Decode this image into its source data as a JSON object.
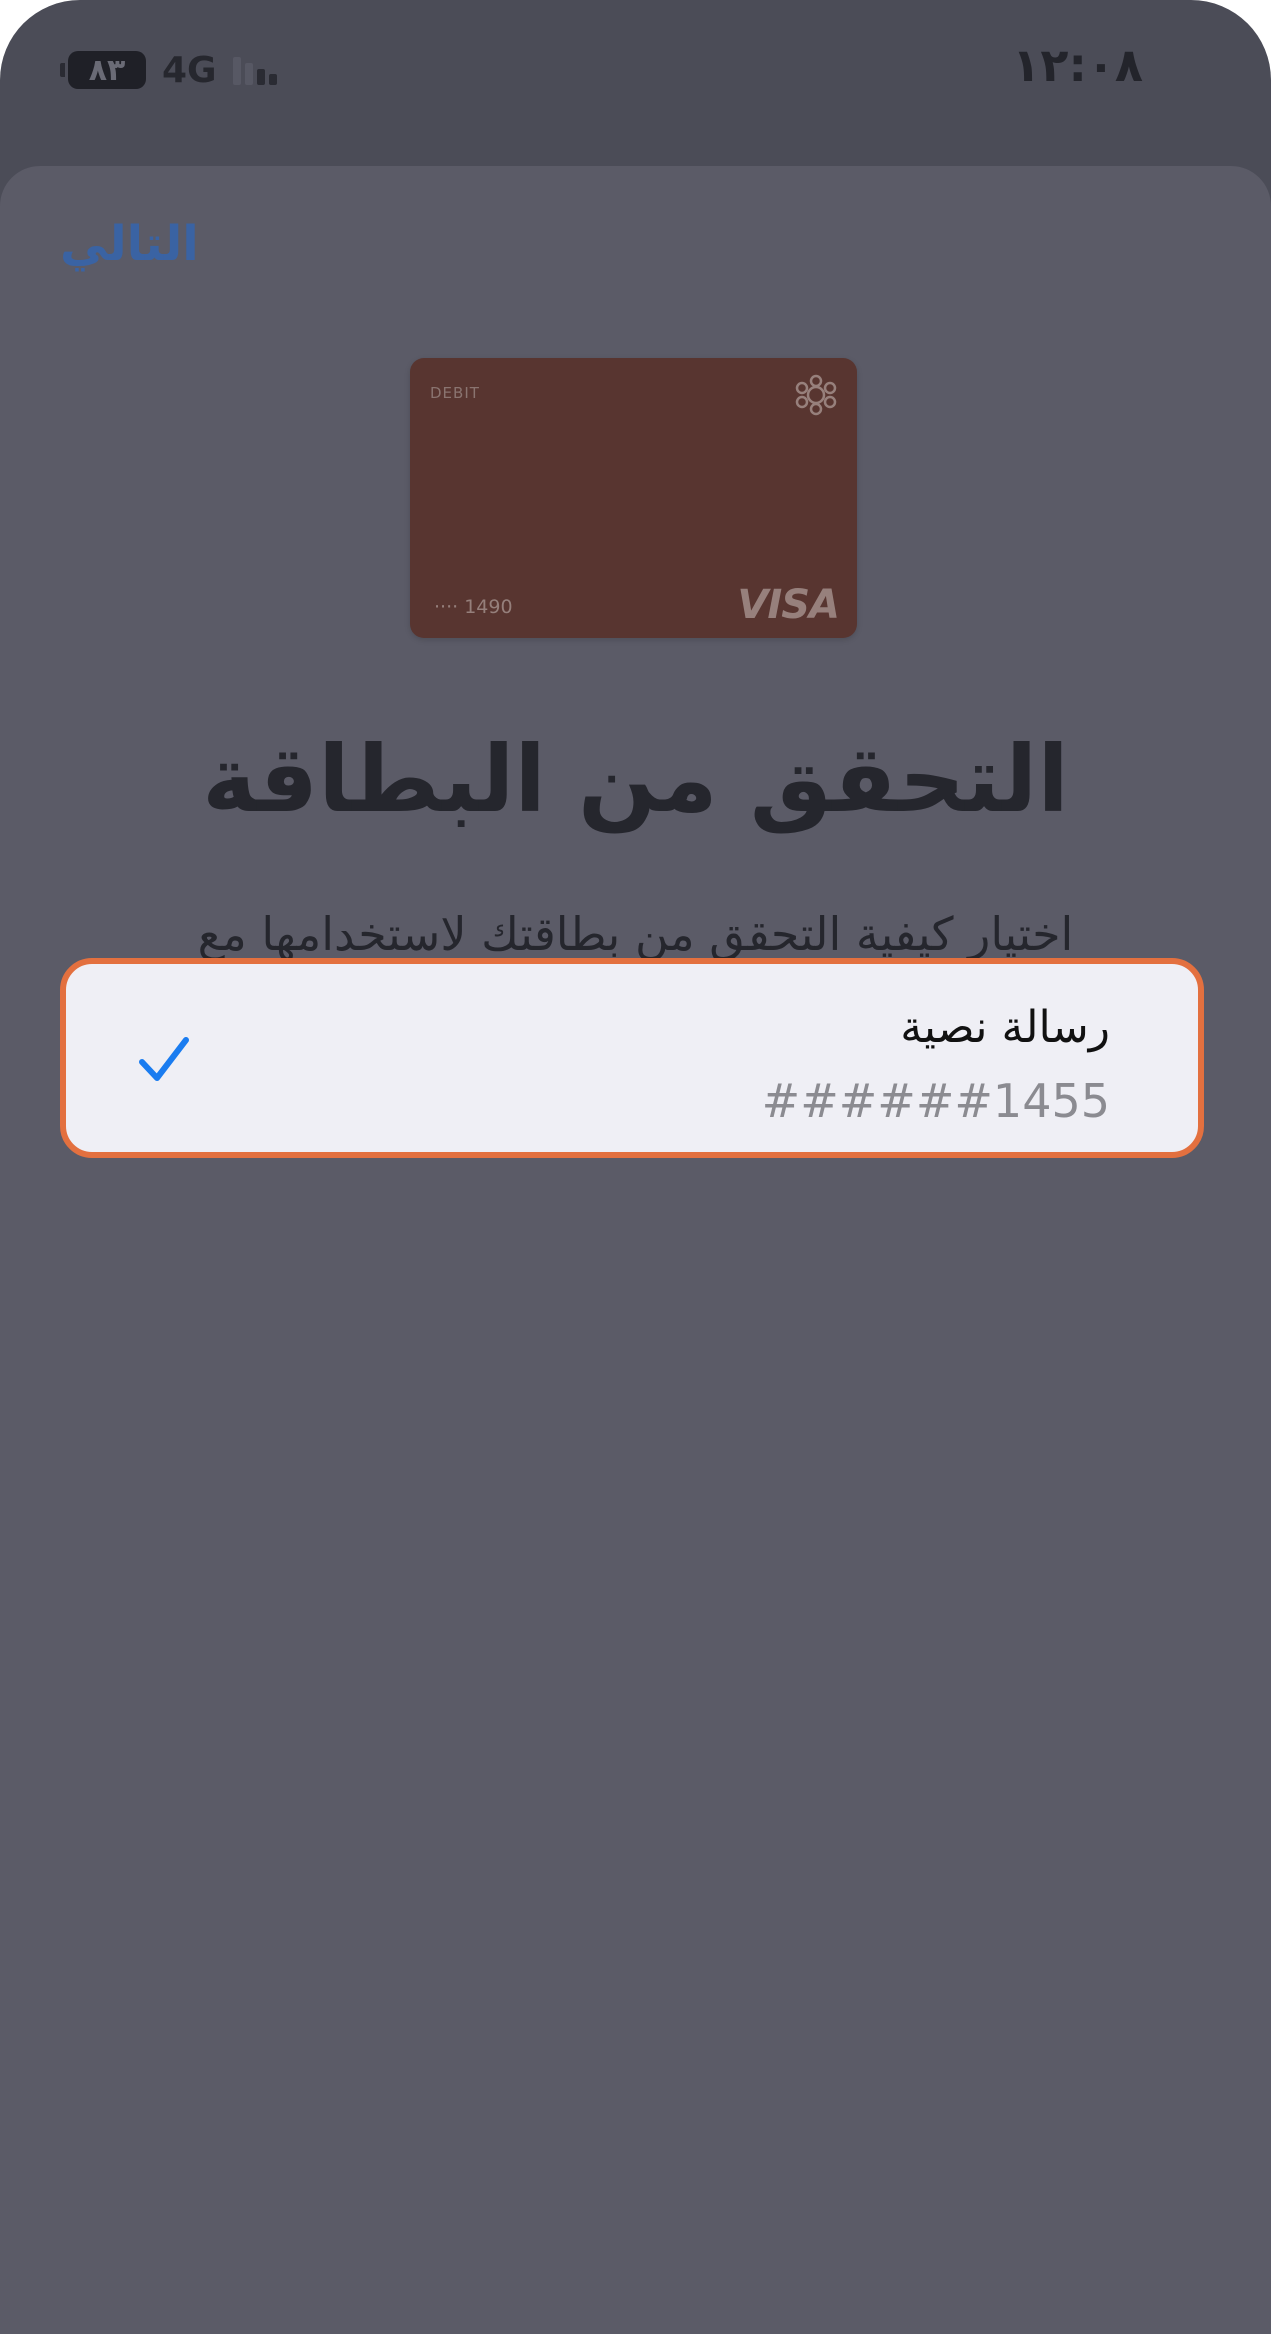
{
  "status_bar": {
    "time": "١٢:٠٨",
    "battery": "٨٣",
    "network": "4G"
  },
  "header": {
    "next_label": "التالي"
  },
  "card": {
    "type_label": "DEBIT",
    "number": "···· 1490",
    "brand": "VISA",
    "color": "#583530"
  },
  "main": {
    "title": "التحقق من البطاقة",
    "subtitle": "اختيار كيفية التحقق من بطاقتك لاستخدامها مع Apple Pay."
  },
  "verification_option": {
    "title": "رسالة نصية",
    "detail": "######1455",
    "selected": true,
    "check_icon": "checkmark-icon",
    "highlight_color": "#e3703f",
    "check_color": "#1a7cf0"
  }
}
